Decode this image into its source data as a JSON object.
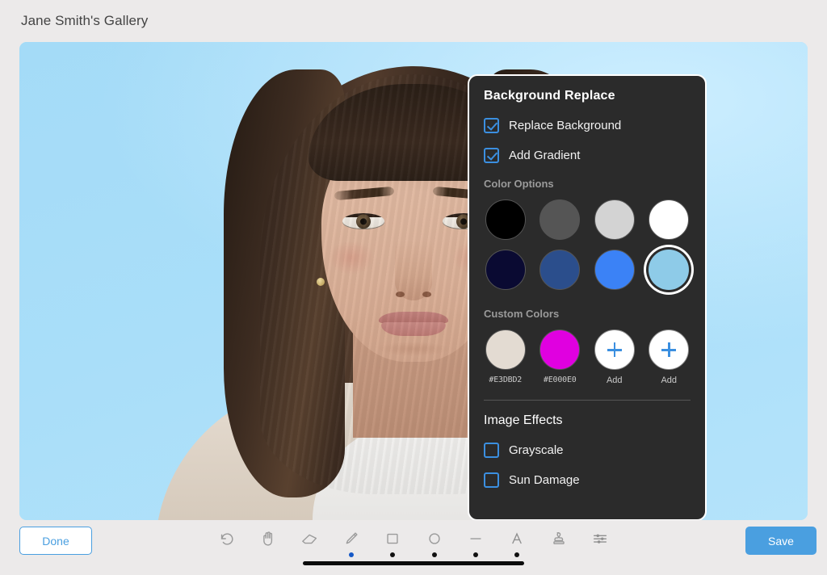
{
  "header": {
    "title": "Jane Smith's Gallery"
  },
  "canvas": {
    "photo_alt": "portrait-photo",
    "background_color": "#a9def9"
  },
  "panel": {
    "title": "Background Replace",
    "toggles": [
      {
        "label": "Replace Background",
        "checked": true
      },
      {
        "label": "Add Gradient",
        "checked": true
      }
    ],
    "color_options_label": "Color Options",
    "color_options": [
      {
        "hex": "#000000",
        "selected": false
      },
      {
        "hex": "#555555",
        "selected": false
      },
      {
        "hex": "#d3d3d3",
        "selected": false
      },
      {
        "hex": "#ffffff",
        "selected": false
      },
      {
        "hex": "#0a0a32",
        "selected": false
      },
      {
        "hex": "#2b4e8c",
        "selected": false
      },
      {
        "hex": "#3b82f6",
        "selected": false
      },
      {
        "hex": "#8ecbe8",
        "selected": true
      }
    ],
    "custom_colors_label": "Custom Colors",
    "custom_colors": [
      {
        "hex": "#E3DBD2",
        "label": "#E3DBD2",
        "is_add": false
      },
      {
        "hex": "#E000E0",
        "label": "#E000E0",
        "is_add": false
      },
      {
        "hex": "#ffffff",
        "label": "Add",
        "is_add": true
      },
      {
        "hex": "#ffffff",
        "label": "Add",
        "is_add": true
      }
    ],
    "effects_title": "Image Effects",
    "effects": [
      {
        "label": "Grayscale",
        "checked": false
      },
      {
        "label": "Sun Damage",
        "checked": false
      }
    ]
  },
  "bottom": {
    "done_label": "Done",
    "save_label": "Save",
    "accent_color": "#4a9fe0",
    "tools": [
      {
        "name": "undo-icon",
        "dot": "none"
      },
      {
        "name": "hand-icon",
        "dot": "none"
      },
      {
        "name": "eraser-icon",
        "dot": "none"
      },
      {
        "name": "pencil-icon",
        "dot": "blue"
      },
      {
        "name": "square-icon",
        "dot": "black"
      },
      {
        "name": "circle-icon",
        "dot": "black"
      },
      {
        "name": "line-icon",
        "dot": "black"
      },
      {
        "name": "text-icon",
        "dot": "black"
      },
      {
        "name": "stamp-icon",
        "dot": "none"
      },
      {
        "name": "sliders-icon",
        "dot": "none"
      }
    ]
  }
}
